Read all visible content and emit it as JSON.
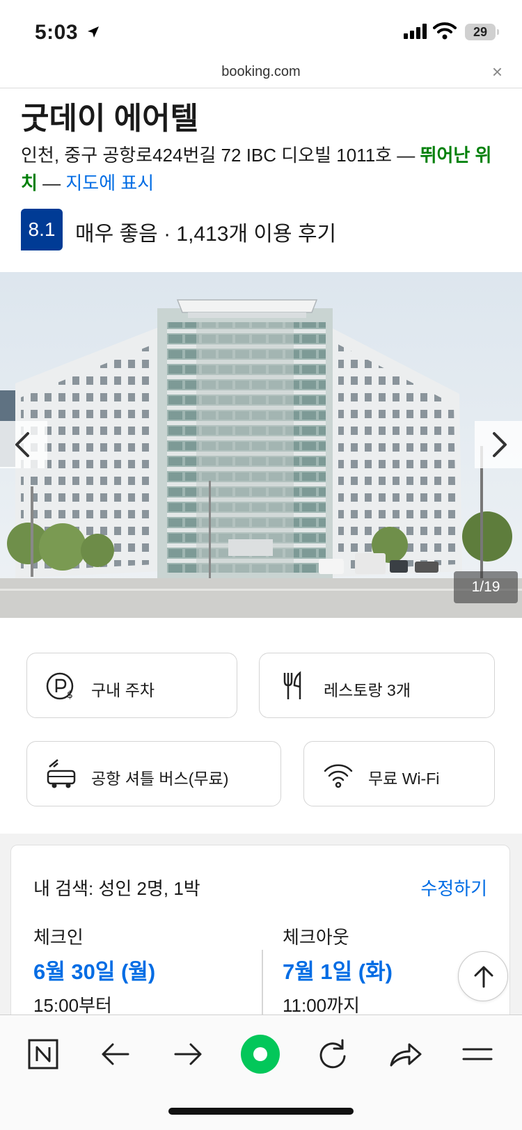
{
  "status": {
    "time": "5:03",
    "battery": "29"
  },
  "browser": {
    "url": "booking.com",
    "close_glyph": "×"
  },
  "hotel": {
    "name": "굿데이 에어텔",
    "address": "인천, 중구 공항로424번길 72 IBC 디오빌 1011호",
    "sep1": " — ",
    "location_note": "뛰어난 위치",
    "sep2": " — ",
    "map_link": "지도에 표시",
    "score": "8.1",
    "score_text": "매우 좋음 · 1,413개 이용 후기"
  },
  "gallery": {
    "counter": "1/19"
  },
  "amenities": [
    {
      "label": "구내 주차",
      "icon": "parking-icon"
    },
    {
      "label": "레스토랑 3개",
      "icon": "restaurant-icon"
    },
    {
      "label": "공항 셔틀 버스(무료)",
      "icon": "shuttle-icon"
    },
    {
      "label": "무료 Wi-Fi",
      "icon": "wifi-icon"
    }
  ],
  "search": {
    "summary": "내 검색: 성인 2명, 1박",
    "edit": "수정하기",
    "checkin": {
      "label": "체크인",
      "date": "6월 30일 (월)",
      "time": "15:00부터"
    },
    "checkout": {
      "label": "체크아웃",
      "date": "7월 1일 (화)",
      "time": "11:00까지"
    }
  },
  "toolbar_icons": [
    "naver-icon",
    "back-arrow-icon",
    "forward-arrow-icon",
    "green-dot-icon",
    "refresh-icon",
    "share-icon",
    "menu-icon"
  ],
  "colors": {
    "brand": "#003b95",
    "link": "#006ce4",
    "good": "#008009",
    "green_dot": "#03c75a"
  }
}
